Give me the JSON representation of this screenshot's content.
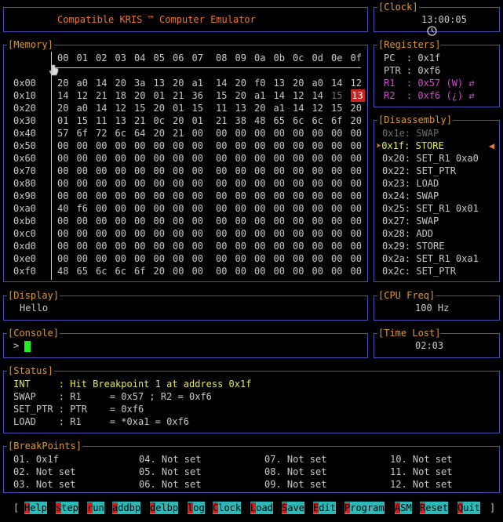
{
  "title": {
    "text": "Compatible KRIS ™ Computer Emulator"
  },
  "clock": {
    "label": "[Clock]",
    "time": "13:00:05",
    "icon": "clock-icon"
  },
  "memory": {
    "label": "[Memory]",
    "icon": "pointer-icon",
    "columns": [
      "00",
      "01",
      "02",
      "03",
      "04",
      "05",
      "06",
      "07",
      "08",
      "09",
      "0a",
      "0b",
      "0c",
      "0d",
      "0e",
      "0f"
    ],
    "rows": [
      {
        "addr": "0x00",
        "cells": [
          "20",
          "a0",
          "14",
          "20",
          "3a",
          "13",
          "20",
          "a1",
          "14",
          "20",
          "f0",
          "13",
          "20",
          "a0",
          "14",
          "12"
        ]
      },
      {
        "addr": "0x10",
        "cells": [
          "14",
          "12",
          "21",
          "18",
          "20",
          "01",
          "21",
          "36",
          "15",
          "20",
          "a1",
          "14",
          "12",
          "14",
          "15",
          "13"
        ]
      },
      {
        "addr": "0x20",
        "cells": [
          "20",
          "a0",
          "14",
          "12",
          "15",
          "20",
          "01",
          "15",
          "11",
          "13",
          "20",
          "a1",
          "14",
          "12",
          "15",
          "20"
        ]
      },
      {
        "addr": "0x30",
        "cells": [
          "01",
          "15",
          "11",
          "13",
          "21",
          "0c",
          "20",
          "01",
          "21",
          "38",
          "48",
          "65",
          "6c",
          "6c",
          "6f",
          "20"
        ]
      },
      {
        "addr": "0x40",
        "cells": [
          "57",
          "6f",
          "72",
          "6c",
          "64",
          "20",
          "21",
          "00",
          "00",
          "00",
          "00",
          "00",
          "00",
          "00",
          "00",
          "00"
        ]
      },
      {
        "addr": "0x50",
        "cells": [
          "00",
          "00",
          "00",
          "00",
          "00",
          "00",
          "00",
          "00",
          "00",
          "00",
          "00",
          "00",
          "00",
          "00",
          "00",
          "00"
        ]
      },
      {
        "addr": "0x60",
        "cells": [
          "00",
          "00",
          "00",
          "00",
          "00",
          "00",
          "00",
          "00",
          "00",
          "00",
          "00",
          "00",
          "00",
          "00",
          "00",
          "00"
        ]
      },
      {
        "addr": "0x70",
        "cells": [
          "00",
          "00",
          "00",
          "00",
          "00",
          "00",
          "00",
          "00",
          "00",
          "00",
          "00",
          "00",
          "00",
          "00",
          "00",
          "00"
        ]
      },
      {
        "addr": "0x80",
        "cells": [
          "00",
          "00",
          "00",
          "00",
          "00",
          "00",
          "00",
          "00",
          "00",
          "00",
          "00",
          "00",
          "00",
          "00",
          "00",
          "00"
        ]
      },
      {
        "addr": "0x90",
        "cells": [
          "00",
          "00",
          "00",
          "00",
          "00",
          "00",
          "00",
          "00",
          "00",
          "00",
          "00",
          "00",
          "00",
          "00",
          "00",
          "00"
        ]
      },
      {
        "addr": "0xa0",
        "cells": [
          "40",
          "f6",
          "00",
          "00",
          "00",
          "00",
          "00",
          "00",
          "00",
          "00",
          "00",
          "00",
          "00",
          "00",
          "00",
          "00"
        ]
      },
      {
        "addr": "0xb0",
        "cells": [
          "00",
          "00",
          "00",
          "00",
          "00",
          "00",
          "00",
          "00",
          "00",
          "00",
          "00",
          "00",
          "00",
          "00",
          "00",
          "00"
        ]
      },
      {
        "addr": "0xc0",
        "cells": [
          "00",
          "00",
          "00",
          "00",
          "00",
          "00",
          "00",
          "00",
          "00",
          "00",
          "00",
          "00",
          "00",
          "00",
          "00",
          "00"
        ]
      },
      {
        "addr": "0xd0",
        "cells": [
          "00",
          "00",
          "00",
          "00",
          "00",
          "00",
          "00",
          "00",
          "00",
          "00",
          "00",
          "00",
          "00",
          "00",
          "00",
          "00"
        ]
      },
      {
        "addr": "0xe0",
        "cells": [
          "00",
          "00",
          "00",
          "00",
          "00",
          "00",
          "00",
          "00",
          "00",
          "00",
          "00",
          "00",
          "00",
          "00",
          "00",
          "00"
        ]
      },
      {
        "addr": "0xf0",
        "cells": [
          "48",
          "65",
          "6c",
          "6c",
          "6f",
          "20",
          "00",
          "00",
          "00",
          "00",
          "00",
          "00",
          "00",
          "00",
          "00",
          "00"
        ]
      }
    ],
    "dimmed": [
      {
        "row": 1,
        "col": 14
      }
    ],
    "highlighted": [
      {
        "row": 1,
        "col": 15
      }
    ]
  },
  "registers": {
    "label": "[Registers]",
    "pc": {
      "name": "PC",
      "value": ": 0x1f"
    },
    "ptr": {
      "name": "PTR",
      "value": ": 0xf6"
    },
    "r1": {
      "name": "R1",
      "value": ": 0x57 (W)",
      "arrow": "⇄"
    },
    "r2": {
      "name": "R2",
      "value": ": 0xf6 (¿)",
      "arrow": "⇄"
    }
  },
  "disassembly": {
    "label": "[Disassembly]",
    "items": [
      {
        "addr": "0x1e:",
        "instr": "SWAP"
      },
      {
        "addr": "0x1f:",
        "instr": "STORE"
      },
      {
        "addr": "0x20:",
        "instr": "SET_R1 0xa0"
      },
      {
        "addr": "0x22:",
        "instr": "SET_PTR"
      },
      {
        "addr": "0x23:",
        "instr": "LOAD"
      },
      {
        "addr": "0x24:",
        "instr": "SWAP"
      },
      {
        "addr": "0x25:",
        "instr": "SET_R1 0x01"
      },
      {
        "addr": "0x27:",
        "instr": "SWAP"
      },
      {
        "addr": "0x28:",
        "instr": "ADD"
      },
      {
        "addr": "0x29:",
        "instr": "STORE"
      },
      {
        "addr": "0x2a:",
        "instr": "SET_R1 0xa1"
      },
      {
        "addr": "0x2c:",
        "instr": "SET_PTR"
      }
    ],
    "current_marker_left": "➤",
    "current_marker_right": "◀"
  },
  "display": {
    "label": "[Display]",
    "text": "Hello"
  },
  "cpu_freq": {
    "label": "[CPU Freq]",
    "value": "100 Hz"
  },
  "console": {
    "label": "[Console]",
    "prompt": ">"
  },
  "time_lost": {
    "label": "[Time Lost]",
    "value": "02:03"
  },
  "status": {
    "label": "[Status]",
    "lines": [
      {
        "key": "INT",
        "text": "     : Hit Breakpoint 1 at address 0x1f"
      },
      {
        "key": "SWAP",
        "text": "    : R1     = 0x57 ; R2 = 0xf6"
      },
      {
        "key": "SET_PTR",
        "text": " : PTR    = 0xf6"
      },
      {
        "key": "LOAD",
        "text": "    : R1     = *0xa1 = 0xf6"
      }
    ]
  },
  "breakpoints": {
    "label": "[BreakPoints]",
    "items": [
      "01. 0x1f",
      "02. Not set",
      "03. Not set",
      "04. Not set",
      "05. Not set",
      "06. Not set",
      "07. Not set",
      "08. Not set",
      "09. Not set",
      "10. Not set",
      "11. Not set",
      "12. Not set"
    ]
  },
  "menu": {
    "open": "[",
    "close": "]",
    "items": [
      {
        "key": "H",
        "rest": "elp"
      },
      {
        "key": "s",
        "rest": "tep"
      },
      {
        "key": "r",
        "rest": "un"
      },
      {
        "key": "a",
        "rest": "ddbp"
      },
      {
        "key": "d",
        "rest": "elbp"
      },
      {
        "key": "l",
        "rest": "og"
      },
      {
        "key": "C",
        "rest": "lock"
      },
      {
        "key": "L",
        "rest": "oad"
      },
      {
        "key": "S",
        "rest": "ave"
      },
      {
        "key": "E",
        "rest": "dit"
      },
      {
        "key": "P",
        "rest": "rogram"
      },
      {
        "key": "A",
        "rest": "SM"
      },
      {
        "key": "R",
        "rest": "eset"
      },
      {
        "key": "Q",
        "rest": "uit"
      }
    ]
  },
  "colors": {
    "border": "#4f4fb8",
    "title": "#e8783a",
    "label": "#d89a3a",
    "highlight": "#d02020",
    "menu": "#2fb8b8",
    "cursor": "#22ee22"
  }
}
